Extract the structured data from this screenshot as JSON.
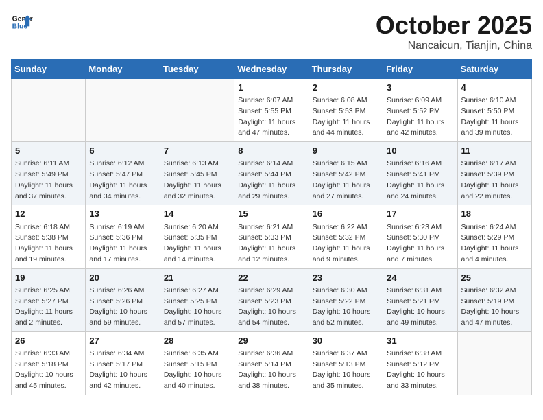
{
  "header": {
    "logo_line1": "General",
    "logo_line2": "Blue",
    "month": "October 2025",
    "location": "Nancaicun, Tianjin, China"
  },
  "weekdays": [
    "Sunday",
    "Monday",
    "Tuesday",
    "Wednesday",
    "Thursday",
    "Friday",
    "Saturday"
  ],
  "weeks": [
    [
      {
        "day": "",
        "info": ""
      },
      {
        "day": "",
        "info": ""
      },
      {
        "day": "",
        "info": ""
      },
      {
        "day": "1",
        "info": "Sunrise: 6:07 AM\nSunset: 5:55 PM\nDaylight: 11 hours and 47 minutes."
      },
      {
        "day": "2",
        "info": "Sunrise: 6:08 AM\nSunset: 5:53 PM\nDaylight: 11 hours and 44 minutes."
      },
      {
        "day": "3",
        "info": "Sunrise: 6:09 AM\nSunset: 5:52 PM\nDaylight: 11 hours and 42 minutes."
      },
      {
        "day": "4",
        "info": "Sunrise: 6:10 AM\nSunset: 5:50 PM\nDaylight: 11 hours and 39 minutes."
      }
    ],
    [
      {
        "day": "5",
        "info": "Sunrise: 6:11 AM\nSunset: 5:49 PM\nDaylight: 11 hours and 37 minutes."
      },
      {
        "day": "6",
        "info": "Sunrise: 6:12 AM\nSunset: 5:47 PM\nDaylight: 11 hours and 34 minutes."
      },
      {
        "day": "7",
        "info": "Sunrise: 6:13 AM\nSunset: 5:45 PM\nDaylight: 11 hours and 32 minutes."
      },
      {
        "day": "8",
        "info": "Sunrise: 6:14 AM\nSunset: 5:44 PM\nDaylight: 11 hours and 29 minutes."
      },
      {
        "day": "9",
        "info": "Sunrise: 6:15 AM\nSunset: 5:42 PM\nDaylight: 11 hours and 27 minutes."
      },
      {
        "day": "10",
        "info": "Sunrise: 6:16 AM\nSunset: 5:41 PM\nDaylight: 11 hours and 24 minutes."
      },
      {
        "day": "11",
        "info": "Sunrise: 6:17 AM\nSunset: 5:39 PM\nDaylight: 11 hours and 22 minutes."
      }
    ],
    [
      {
        "day": "12",
        "info": "Sunrise: 6:18 AM\nSunset: 5:38 PM\nDaylight: 11 hours and 19 minutes."
      },
      {
        "day": "13",
        "info": "Sunrise: 6:19 AM\nSunset: 5:36 PM\nDaylight: 11 hours and 17 minutes."
      },
      {
        "day": "14",
        "info": "Sunrise: 6:20 AM\nSunset: 5:35 PM\nDaylight: 11 hours and 14 minutes."
      },
      {
        "day": "15",
        "info": "Sunrise: 6:21 AM\nSunset: 5:33 PM\nDaylight: 11 hours and 12 minutes."
      },
      {
        "day": "16",
        "info": "Sunrise: 6:22 AM\nSunset: 5:32 PM\nDaylight: 11 hours and 9 minutes."
      },
      {
        "day": "17",
        "info": "Sunrise: 6:23 AM\nSunset: 5:30 PM\nDaylight: 11 hours and 7 minutes."
      },
      {
        "day": "18",
        "info": "Sunrise: 6:24 AM\nSunset: 5:29 PM\nDaylight: 11 hours and 4 minutes."
      }
    ],
    [
      {
        "day": "19",
        "info": "Sunrise: 6:25 AM\nSunset: 5:27 PM\nDaylight: 11 hours and 2 minutes."
      },
      {
        "day": "20",
        "info": "Sunrise: 6:26 AM\nSunset: 5:26 PM\nDaylight: 10 hours and 59 minutes."
      },
      {
        "day": "21",
        "info": "Sunrise: 6:27 AM\nSunset: 5:25 PM\nDaylight: 10 hours and 57 minutes."
      },
      {
        "day": "22",
        "info": "Sunrise: 6:29 AM\nSunset: 5:23 PM\nDaylight: 10 hours and 54 minutes."
      },
      {
        "day": "23",
        "info": "Sunrise: 6:30 AM\nSunset: 5:22 PM\nDaylight: 10 hours and 52 minutes."
      },
      {
        "day": "24",
        "info": "Sunrise: 6:31 AM\nSunset: 5:21 PM\nDaylight: 10 hours and 49 minutes."
      },
      {
        "day": "25",
        "info": "Sunrise: 6:32 AM\nSunset: 5:19 PM\nDaylight: 10 hours and 47 minutes."
      }
    ],
    [
      {
        "day": "26",
        "info": "Sunrise: 6:33 AM\nSunset: 5:18 PM\nDaylight: 10 hours and 45 minutes."
      },
      {
        "day": "27",
        "info": "Sunrise: 6:34 AM\nSunset: 5:17 PM\nDaylight: 10 hours and 42 minutes."
      },
      {
        "day": "28",
        "info": "Sunrise: 6:35 AM\nSunset: 5:15 PM\nDaylight: 10 hours and 40 minutes."
      },
      {
        "day": "29",
        "info": "Sunrise: 6:36 AM\nSunset: 5:14 PM\nDaylight: 10 hours and 38 minutes."
      },
      {
        "day": "30",
        "info": "Sunrise: 6:37 AM\nSunset: 5:13 PM\nDaylight: 10 hours and 35 minutes."
      },
      {
        "day": "31",
        "info": "Sunrise: 6:38 AM\nSunset: 5:12 PM\nDaylight: 10 hours and 33 minutes."
      },
      {
        "day": "",
        "info": ""
      }
    ]
  ],
  "row_classes": [
    "row-white",
    "row-shaded",
    "row-white",
    "row-shaded",
    "row-white"
  ]
}
